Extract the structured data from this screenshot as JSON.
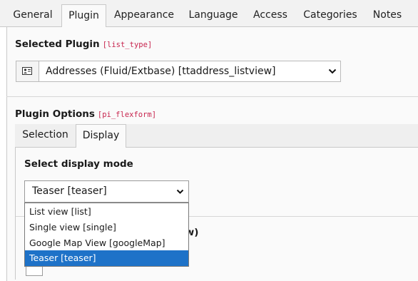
{
  "tabs": [
    {
      "label": "General",
      "active": false
    },
    {
      "label": "Plugin",
      "active": true
    },
    {
      "label": "Appearance",
      "active": false
    },
    {
      "label": "Language",
      "active": false
    },
    {
      "label": "Access",
      "active": false
    },
    {
      "label": "Categories",
      "active": false
    },
    {
      "label": "Notes",
      "active": false
    }
  ],
  "selected_plugin": {
    "label": "Selected Plugin",
    "field_name": "[list_type]",
    "value": "Addresses (Fluid/Extbase) [ttaddress_listview]",
    "icon": "address-card-icon"
  },
  "plugin_options": {
    "label": "Plugin Options",
    "field_name": "[pi_flexform]",
    "tabs": [
      {
        "label": "Selection",
        "active": false
      },
      {
        "label": "Display",
        "active": true
      }
    ],
    "display_mode": {
      "label": "Select display mode",
      "value": "Teaser [teaser]",
      "options": [
        {
          "label": "List view [list]",
          "selected": false
        },
        {
          "label": "Single view [single]",
          "selected": false
        },
        {
          "label": "Google Map View [googleMap]",
          "selected": false
        },
        {
          "label": "Teaser [teaser]",
          "selected": true
        }
      ]
    },
    "partially_hidden_label": "iew)"
  },
  "colors": {
    "accent": "#1e72c8",
    "field_name": "#c7254e"
  }
}
